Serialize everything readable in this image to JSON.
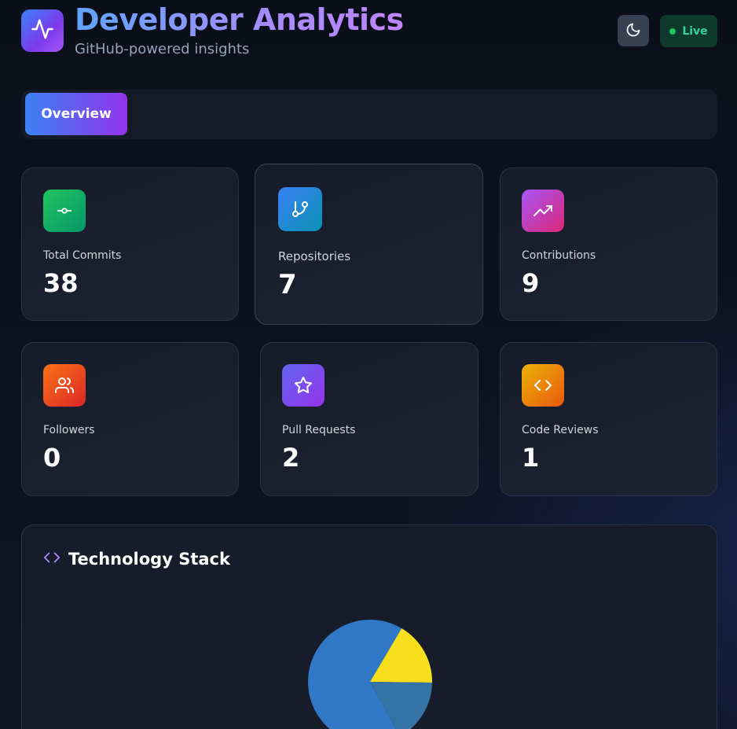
{
  "header": {
    "title": "Developer Analytics",
    "subtitle": "GitHub-powered insights",
    "logo_icon": "activity-icon",
    "theme_icon": "moon-icon",
    "live_label": "Live"
  },
  "tabs": [
    {
      "label": "Overview",
      "active": true
    }
  ],
  "stats": [
    {
      "label": "Total Commits",
      "value": "38",
      "icon": "git-commit-icon",
      "gradient": [
        "#22c55e",
        "#059669"
      ]
    },
    {
      "label": "Repositories",
      "value": "7",
      "icon": "git-branch-icon",
      "gradient": [
        "#3b82f6",
        "#0891b2"
      ]
    },
    {
      "label": "Contributions",
      "value": "9",
      "icon": "trending-up-icon",
      "gradient": [
        "#a855f7",
        "#db2777"
      ]
    },
    {
      "label": "Followers",
      "value": "0",
      "icon": "users-icon",
      "gradient": [
        "#f97316",
        "#dc2626"
      ]
    },
    {
      "label": "Pull Requests",
      "value": "2",
      "icon": "star-icon",
      "gradient": [
        "#6366f1",
        "#9333ea"
      ]
    },
    {
      "label": "Code Reviews",
      "value": "1",
      "icon": "code-icon",
      "gradient": [
        "#eab308",
        "#ea580c"
      ]
    }
  ],
  "tech_stack": {
    "title": "Technology Stack",
    "icon": "code-icon"
  },
  "chart_data": {
    "type": "pie",
    "slices": [
      {
        "value": 0.665,
        "color": "#3178c6"
      },
      {
        "value": 0.167,
        "color": "#f7df1e"
      },
      {
        "value": 0.168,
        "color": "#3572a5"
      }
    ]
  },
  "colors": {
    "accent_blue": "#3b82f6",
    "accent_purple": "#9333ea",
    "live_green": "#22c55e"
  }
}
